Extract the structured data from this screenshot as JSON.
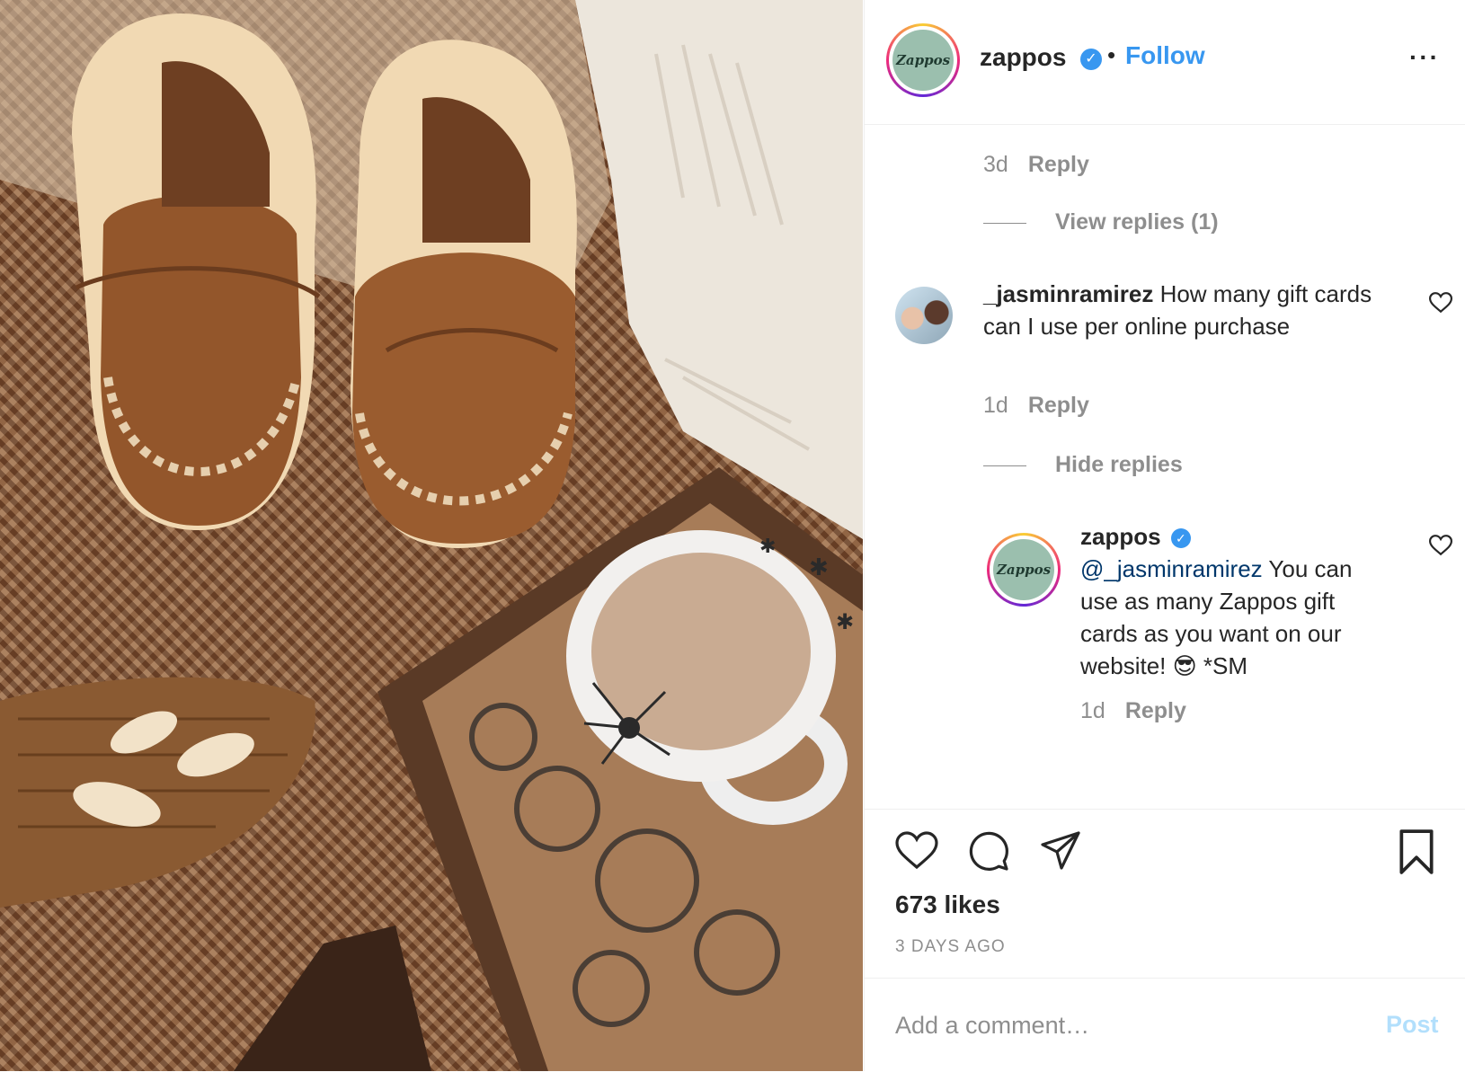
{
  "post": {
    "username": "zappos",
    "avatar_text": "Zappos",
    "follow_label": "Follow",
    "separator": "•",
    "more_icon": "···"
  },
  "comments": {
    "truncated_prev_time": "3d",
    "reply_label": "Reply",
    "view_replies_label": "View replies (1)",
    "items": [
      {
        "username": "_jasminramirez",
        "text": "How many gift cards can I use per online purchase",
        "time": "1d",
        "reply_label": "Reply",
        "hide_replies_label": "Hide replies"
      }
    ],
    "reply": {
      "username": "zappos",
      "avatar_text": "Zappos",
      "mention": "@_jasminramirez",
      "text": "You can use as many Zappos gift cards as you want on our website! 😎 *SM",
      "time": "1d",
      "reply_label": "Reply"
    }
  },
  "actions": {
    "likes": "673 likes",
    "posted_ago": "3 DAYS AGO"
  },
  "add_comment": {
    "placeholder": "Add a comment…",
    "post_label": "Post"
  },
  "colors": {
    "accent": "#3897f0",
    "muted": "#8e8e8e",
    "post_disabled": "#b2dffc",
    "mention": "#00376b"
  }
}
